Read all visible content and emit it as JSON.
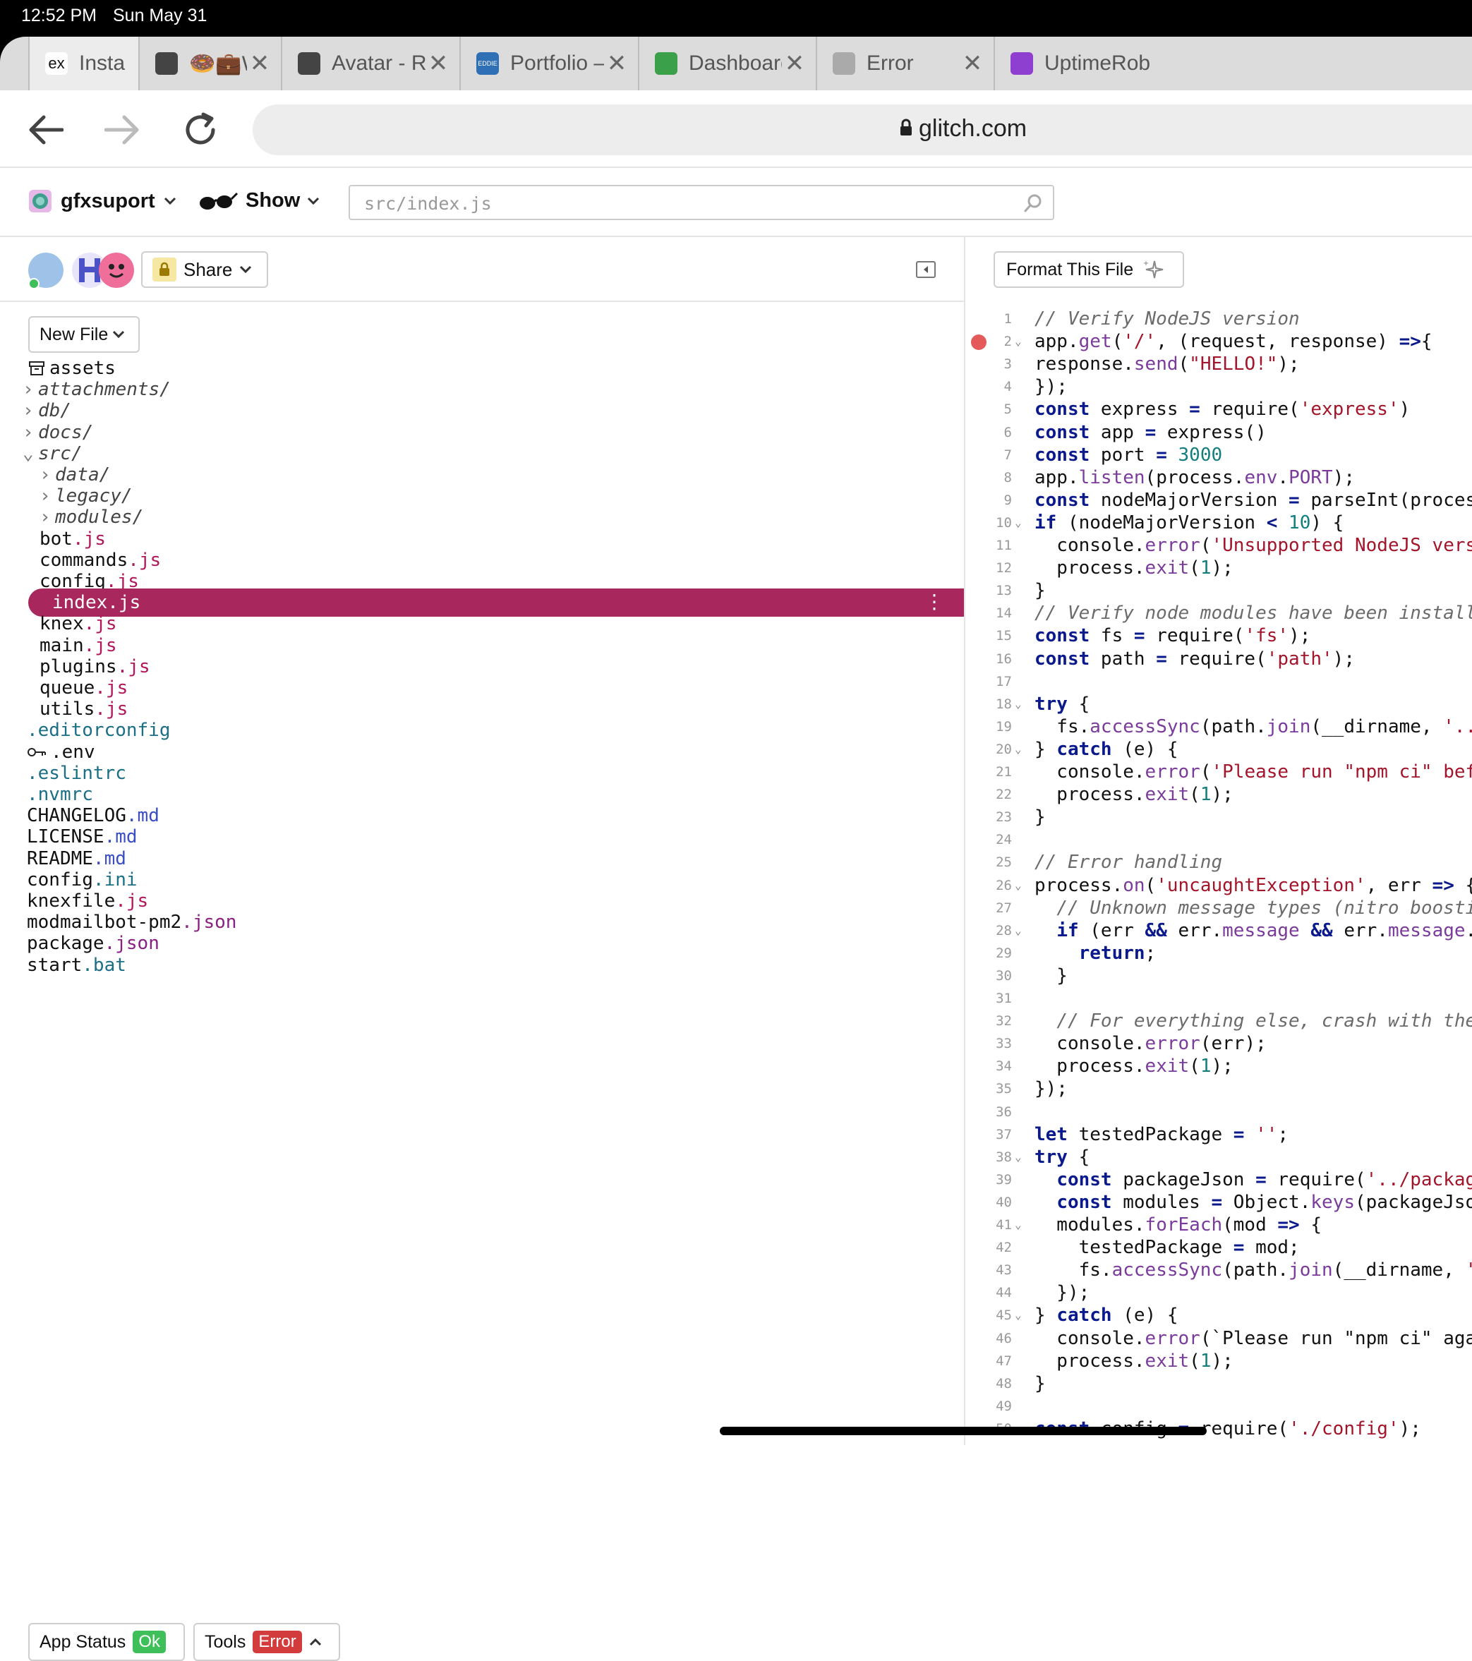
{
  "status_bar": {
    "time": "12:52 PM",
    "date": "Sun May 31"
  },
  "browser": {
    "tabs": [
      {
        "title": "Insta",
        "favicon": "ex",
        "favicon_bg": "#ffffff"
      },
      {
        "title": "🍩💼Work At I",
        "favicon": "roblox-icon",
        "favicon_bg": "#444444"
      },
      {
        "title": "Avatar - Roblox",
        "favicon": "roblox-icon",
        "favicon_bg": "#444444"
      },
      {
        "title": "Portfolio – Eddi",
        "favicon": "EDDIE",
        "favicon_bg": "#2f6fb5"
      },
      {
        "title": "Dashboard | Up",
        "favicon": "uptime-icon",
        "favicon_bg": "#3aa14a"
      },
      {
        "title": "Error",
        "favicon": "globe-icon",
        "favicon_bg": "#aaaaaa"
      },
      {
        "title": "UptimeRob",
        "favicon": "uptime-robot-icon",
        "favicon_bg": "#8e3fcf"
      }
    ],
    "address": "glitch.com"
  },
  "glitch": {
    "project_name": "gfxsuport",
    "show_label": "Show",
    "file_search_value": "src/index.js",
    "share_label": "Share",
    "new_file_label": "New File",
    "format_label": "Format This File",
    "app_status_label": "App Status",
    "app_status_badge": "Ok",
    "tools_label": "Tools",
    "tools_badge": "Error"
  },
  "file_tree": [
    {
      "name": "assets",
      "ext": "",
      "kind": "assets"
    },
    {
      "name": "attachments/",
      "ext": "",
      "kind": "folder-closed"
    },
    {
      "name": "db/",
      "ext": "",
      "kind": "folder-closed"
    },
    {
      "name": "docs/",
      "ext": "",
      "kind": "folder-closed"
    },
    {
      "name": "src/",
      "ext": "",
      "kind": "folder-open"
    },
    {
      "name": "data/",
      "ext": "",
      "kind": "folder-closed"
    },
    {
      "name": "legacy/",
      "ext": "",
      "kind": "folder-closed"
    },
    {
      "name": "modules/",
      "ext": "",
      "kind": "folder-closed"
    },
    {
      "name": "bot",
      "ext": ".js",
      "kind": "file"
    },
    {
      "name": "commands",
      "ext": ".js",
      "kind": "file"
    },
    {
      "name": "config",
      "ext": ".js",
      "kind": "file"
    },
    {
      "name": "index.js",
      "ext": "",
      "kind": "selected"
    },
    {
      "name": "knex",
      "ext": ".js",
      "kind": "file"
    },
    {
      "name": "main",
      "ext": ".js",
      "kind": "file"
    },
    {
      "name": "plugins",
      "ext": ".js",
      "kind": "file"
    },
    {
      "name": "queue",
      "ext": ".js",
      "kind": "file"
    },
    {
      "name": "utils",
      "ext": ".js",
      "kind": "file"
    },
    {
      "name": "",
      "ext": ".editorconfig",
      "kind": "dotfile"
    },
    {
      "name": ".env",
      "ext": "",
      "kind": "env"
    },
    {
      "name": "",
      "ext": ".eslintrc",
      "kind": "dotfile"
    },
    {
      "name": "",
      "ext": ".nvmrc",
      "kind": "dotfile"
    },
    {
      "name": "CHANGELOG",
      "ext": ".md",
      "kind": "root-file"
    },
    {
      "name": "LICENSE",
      "ext": ".md",
      "kind": "root-file"
    },
    {
      "name": "README",
      "ext": ".md",
      "kind": "root-file"
    },
    {
      "name": "config",
      "ext": ".ini",
      "kind": "root-file"
    },
    {
      "name": "knexfile",
      "ext": ".js",
      "kind": "root-file"
    },
    {
      "name": "modmailbot-pm2",
      "ext": ".json",
      "kind": "root-file"
    },
    {
      "name": "package",
      "ext": ".json",
      "kind": "root-file"
    },
    {
      "name": "start",
      "ext": ".bat",
      "kind": "root-file"
    }
  ],
  "code_lines": [
    {
      "n": "1",
      "fold": false,
      "bp": false,
      "tokens": [
        [
          "cm",
          "// Verify NodeJS version"
        ]
      ]
    },
    {
      "n": "2",
      "fold": true,
      "bp": true,
      "tokens": [
        [
          "",
          "app."
        ],
        [
          "fn",
          "get"
        ],
        [
          "",
          "("
        ],
        [
          "str",
          "'/'"
        ],
        [
          "",
          ", (request, response) "
        ],
        [
          "kw",
          "=>"
        ],
        [
          "",
          "{"
        ]
      ]
    },
    {
      "n": "3",
      "fold": false,
      "bp": false,
      "tokens": [
        [
          "",
          "response."
        ],
        [
          "fn",
          "send"
        ],
        [
          "",
          "("
        ],
        [
          "str",
          "\"HELLO!\""
        ],
        [
          "",
          ");"
        ]
      ]
    },
    {
      "n": "4",
      "fold": false,
      "bp": false,
      "tokens": [
        [
          "",
          "});"
        ]
      ]
    },
    {
      "n": "5",
      "fold": false,
      "bp": false,
      "tokens": [
        [
          "kw",
          "const"
        ],
        [
          "",
          " express "
        ],
        [
          "kw",
          "="
        ],
        [
          "",
          " require("
        ],
        [
          "str",
          "'express'"
        ],
        [
          "",
          ")"
        ]
      ]
    },
    {
      "n": "6",
      "fold": false,
      "bp": false,
      "tokens": [
        [
          "kw",
          "const"
        ],
        [
          "",
          " app "
        ],
        [
          "kw",
          "="
        ],
        [
          "",
          " express()"
        ]
      ]
    },
    {
      "n": "7",
      "fold": false,
      "bp": false,
      "tokens": [
        [
          "kw",
          "const"
        ],
        [
          "",
          " port "
        ],
        [
          "kw",
          "="
        ],
        [
          "",
          " "
        ],
        [
          "num",
          "3000"
        ]
      ]
    },
    {
      "n": "8",
      "fold": false,
      "bp": false,
      "tokens": [
        [
          "",
          "app."
        ],
        [
          "fn",
          "listen"
        ],
        [
          "",
          "(process."
        ],
        [
          "fn",
          "env"
        ],
        [
          "",
          "."
        ],
        [
          "fn",
          "PORT"
        ],
        [
          "",
          ");"
        ]
      ]
    },
    {
      "n": "9",
      "fold": false,
      "bp": false,
      "tokens": [
        [
          "kw",
          "const"
        ],
        [
          "",
          " nodeMajorVersion "
        ],
        [
          "kw",
          "="
        ],
        [
          "",
          " parseInt(proces"
        ]
      ]
    },
    {
      "n": "10",
      "fold": true,
      "bp": false,
      "tokens": [
        [
          "kw",
          "if"
        ],
        [
          "",
          " (nodeMajorVersion "
        ],
        [
          "kw",
          "<"
        ],
        [
          "",
          " "
        ],
        [
          "num",
          "10"
        ],
        [
          "",
          ") {"
        ]
      ]
    },
    {
      "n": "11",
      "fold": false,
      "bp": false,
      "tokens": [
        [
          "",
          "  console."
        ],
        [
          "fn",
          "error"
        ],
        [
          "",
          "("
        ],
        [
          "str",
          "'Unsupported NodeJS vers"
        ]
      ]
    },
    {
      "n": "12",
      "fold": false,
      "bp": false,
      "tokens": [
        [
          "",
          "  process."
        ],
        [
          "fn",
          "exit"
        ],
        [
          "",
          "("
        ],
        [
          "num",
          "1"
        ],
        [
          "",
          ");"
        ]
      ]
    },
    {
      "n": "13",
      "fold": false,
      "bp": false,
      "tokens": [
        [
          "",
          "}"
        ]
      ]
    },
    {
      "n": "14",
      "fold": false,
      "bp": false,
      "tokens": [
        [
          "cm",
          "// Verify node modules have been install"
        ]
      ]
    },
    {
      "n": "15",
      "fold": false,
      "bp": false,
      "tokens": [
        [
          "kw",
          "const"
        ],
        [
          "",
          " fs "
        ],
        [
          "kw",
          "="
        ],
        [
          "",
          " require("
        ],
        [
          "str",
          "'fs'"
        ],
        [
          "",
          ");"
        ]
      ]
    },
    {
      "n": "16",
      "fold": false,
      "bp": false,
      "tokens": [
        [
          "kw",
          "const"
        ],
        [
          "",
          " path "
        ],
        [
          "kw",
          "="
        ],
        [
          "",
          " require("
        ],
        [
          "str",
          "'path'"
        ],
        [
          "",
          ");"
        ]
      ]
    },
    {
      "n": "17",
      "fold": false,
      "bp": false,
      "tokens": []
    },
    {
      "n": "18",
      "fold": true,
      "bp": false,
      "tokens": [
        [
          "kw",
          "try"
        ],
        [
          "",
          " {"
        ]
      ]
    },
    {
      "n": "19",
      "fold": false,
      "bp": false,
      "tokens": [
        [
          "",
          "  fs."
        ],
        [
          "fn",
          "accessSync"
        ],
        [
          "",
          "(path."
        ],
        [
          "fn",
          "join"
        ],
        [
          "",
          "(__dirname, "
        ],
        [
          "str",
          "'.."
        ]
      ]
    },
    {
      "n": "20",
      "fold": true,
      "bp": false,
      "tokens": [
        [
          "",
          "} "
        ],
        [
          "kw",
          "catch"
        ],
        [
          "",
          " (e) {"
        ]
      ]
    },
    {
      "n": "21",
      "fold": false,
      "bp": false,
      "tokens": [
        [
          "",
          "  console."
        ],
        [
          "fn",
          "error"
        ],
        [
          "",
          "("
        ],
        [
          "str",
          "'Please run \"npm ci\" bef"
        ]
      ]
    },
    {
      "n": "22",
      "fold": false,
      "bp": false,
      "tokens": [
        [
          "",
          "  process."
        ],
        [
          "fn",
          "exit"
        ],
        [
          "",
          "("
        ],
        [
          "num",
          "1"
        ],
        [
          "",
          ");"
        ]
      ]
    },
    {
      "n": "23",
      "fold": false,
      "bp": false,
      "tokens": [
        [
          "",
          "}"
        ]
      ]
    },
    {
      "n": "24",
      "fold": false,
      "bp": false,
      "tokens": []
    },
    {
      "n": "25",
      "fold": false,
      "bp": false,
      "tokens": [
        [
          "cm",
          "// Error handling"
        ]
      ]
    },
    {
      "n": "26",
      "fold": true,
      "bp": false,
      "tokens": [
        [
          "",
          "process."
        ],
        [
          "fn",
          "on"
        ],
        [
          "",
          "("
        ],
        [
          "str",
          "'uncaughtException'"
        ],
        [
          "",
          ", err "
        ],
        [
          "kw",
          "=>"
        ],
        [
          "",
          " {"
        ]
      ]
    },
    {
      "n": "27",
      "fold": false,
      "bp": false,
      "tokens": [
        [
          "",
          "  "
        ],
        [
          "cm",
          "// Unknown message types (nitro boosti"
        ]
      ]
    },
    {
      "n": "28",
      "fold": true,
      "bp": false,
      "tokens": [
        [
          "",
          "  "
        ],
        [
          "kw",
          "if"
        ],
        [
          "",
          " (err "
        ],
        [
          "kw",
          "&&"
        ],
        [
          "",
          " err."
        ],
        [
          "fn",
          "message"
        ],
        [
          "",
          " "
        ],
        [
          "kw",
          "&&"
        ],
        [
          "",
          " err."
        ],
        [
          "fn",
          "message"
        ],
        [
          "",
          "."
        ]
      ]
    },
    {
      "n": "29",
      "fold": false,
      "bp": false,
      "tokens": [
        [
          "",
          "    "
        ],
        [
          "kw",
          "return"
        ],
        [
          "",
          ";"
        ]
      ]
    },
    {
      "n": "30",
      "fold": false,
      "bp": false,
      "tokens": [
        [
          "",
          "  }"
        ]
      ]
    },
    {
      "n": "31",
      "fold": false,
      "bp": false,
      "tokens": []
    },
    {
      "n": "32",
      "fold": false,
      "bp": false,
      "tokens": [
        [
          "",
          "  "
        ],
        [
          "cm",
          "// For everything else, crash with the"
        ]
      ]
    },
    {
      "n": "33",
      "fold": false,
      "bp": false,
      "tokens": [
        [
          "",
          "  console."
        ],
        [
          "fn",
          "error"
        ],
        [
          "",
          "(err);"
        ]
      ]
    },
    {
      "n": "34",
      "fold": false,
      "bp": false,
      "tokens": [
        [
          "",
          "  process."
        ],
        [
          "fn",
          "exit"
        ],
        [
          "",
          "("
        ],
        [
          "num",
          "1"
        ],
        [
          "",
          ");"
        ]
      ]
    },
    {
      "n": "35",
      "fold": false,
      "bp": false,
      "tokens": [
        [
          "",
          "});"
        ]
      ]
    },
    {
      "n": "36",
      "fold": false,
      "bp": false,
      "tokens": []
    },
    {
      "n": "37",
      "fold": false,
      "bp": false,
      "tokens": [
        [
          "kw",
          "let"
        ],
        [
          "",
          " testedPackage "
        ],
        [
          "kw",
          "="
        ],
        [
          "",
          " "
        ],
        [
          "str",
          "''"
        ],
        [
          "",
          ";"
        ]
      ]
    },
    {
      "n": "38",
      "fold": true,
      "bp": false,
      "tokens": [
        [
          "kw",
          "try"
        ],
        [
          "",
          " {"
        ]
      ]
    },
    {
      "n": "39",
      "fold": false,
      "bp": false,
      "tokens": [
        [
          "",
          "  "
        ],
        [
          "kw",
          "const"
        ],
        [
          "",
          " packageJson "
        ],
        [
          "kw",
          "="
        ],
        [
          "",
          " require("
        ],
        [
          "str",
          "'../packag"
        ]
      ]
    },
    {
      "n": "40",
      "fold": false,
      "bp": false,
      "tokens": [
        [
          "",
          "  "
        ],
        [
          "kw",
          "const"
        ],
        [
          "",
          " modules "
        ],
        [
          "kw",
          "="
        ],
        [
          "",
          " Object."
        ],
        [
          "fn",
          "keys"
        ],
        [
          "",
          "(packageJso"
        ]
      ]
    },
    {
      "n": "41",
      "fold": true,
      "bp": false,
      "tokens": [
        [
          "",
          "  modules."
        ],
        [
          "fn",
          "forEach"
        ],
        [
          "",
          "(mod "
        ],
        [
          "kw",
          "=>"
        ],
        [
          "",
          " {"
        ]
      ]
    },
    {
      "n": "42",
      "fold": false,
      "bp": false,
      "tokens": [
        [
          "",
          "    testedPackage "
        ],
        [
          "kw",
          "="
        ],
        [
          "",
          " mod;"
        ]
      ]
    },
    {
      "n": "43",
      "fold": false,
      "bp": false,
      "tokens": [
        [
          "",
          "    fs."
        ],
        [
          "fn",
          "accessSync"
        ],
        [
          "",
          "(path."
        ],
        [
          "fn",
          "join"
        ],
        [
          "",
          "(__dirname, "
        ],
        [
          "str",
          "'"
        ]
      ]
    },
    {
      "n": "44",
      "fold": false,
      "bp": false,
      "tokens": [
        [
          "",
          "  });"
        ]
      ]
    },
    {
      "n": "45",
      "fold": true,
      "bp": false,
      "tokens": [
        [
          "",
          "} "
        ],
        [
          "kw",
          "catch"
        ],
        [
          "",
          " (e) {"
        ]
      ]
    },
    {
      "n": "46",
      "fold": false,
      "bp": false,
      "tokens": [
        [
          "",
          "  console."
        ],
        [
          "fn",
          "error"
        ],
        [
          "",
          "(`Please run \"npm ci\" aga"
        ]
      ]
    },
    {
      "n": "47",
      "fold": false,
      "bp": false,
      "tokens": [
        [
          "",
          "  process."
        ],
        [
          "fn",
          "exit"
        ],
        [
          "",
          "("
        ],
        [
          "num",
          "1"
        ],
        [
          "",
          ");"
        ]
      ]
    },
    {
      "n": "48",
      "fold": false,
      "bp": false,
      "tokens": [
        [
          "",
          "}"
        ]
      ]
    },
    {
      "n": "49",
      "fold": false,
      "bp": false,
      "tokens": []
    },
    {
      "n": "50",
      "fold": false,
      "bp": false,
      "tokens": [
        [
          "kw",
          "const"
        ],
        [
          "",
          " config "
        ],
        [
          "kw",
          "="
        ],
        [
          "",
          " require("
        ],
        [
          "str",
          "'./config'"
        ],
        [
          "",
          ");"
        ]
      ]
    }
  ],
  "colors": {
    "selected_row": "#a8275d",
    "ok_badge": "#3fbf5a",
    "error_badge": "#d23c3c",
    "breakpoint": "#e45a5a"
  }
}
